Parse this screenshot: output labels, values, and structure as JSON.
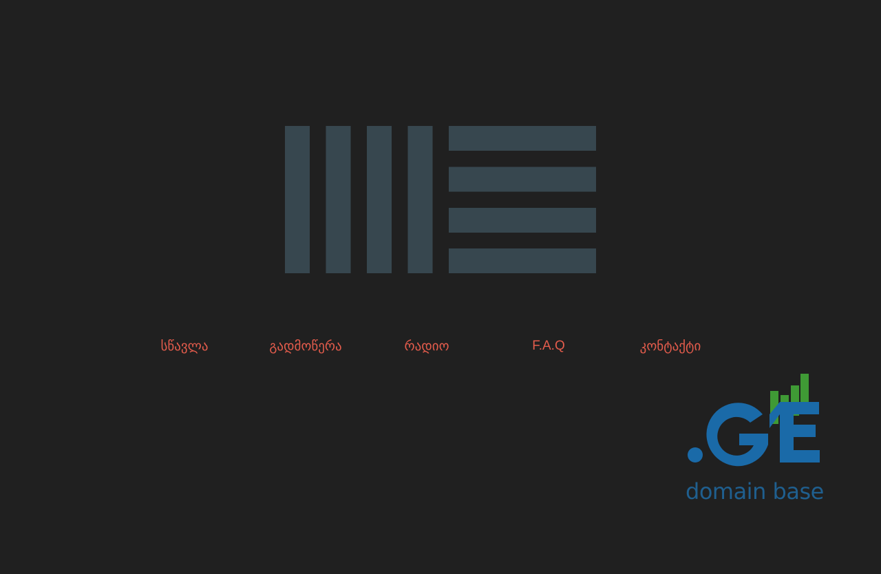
{
  "colors": {
    "background": "#202020",
    "logo": "#37474f",
    "nav_text": "#e45c4c",
    "brand_blue": "#1a6aa8",
    "brand_green": "#3f9a35",
    "caption_blue": "#1f5f8f"
  },
  "logo": {
    "icon": "ableton-logo-icon"
  },
  "nav": {
    "items": [
      {
        "label": "სწავლა"
      },
      {
        "label": "გადმოწერა"
      },
      {
        "label": "რადიო"
      },
      {
        "label": "F.A.Q"
      },
      {
        "label": "კონტაქტი"
      }
    ]
  },
  "badge": {
    "icon": "domain-ge-logo-icon",
    "main_text": ".GE",
    "caption": "domain base"
  }
}
